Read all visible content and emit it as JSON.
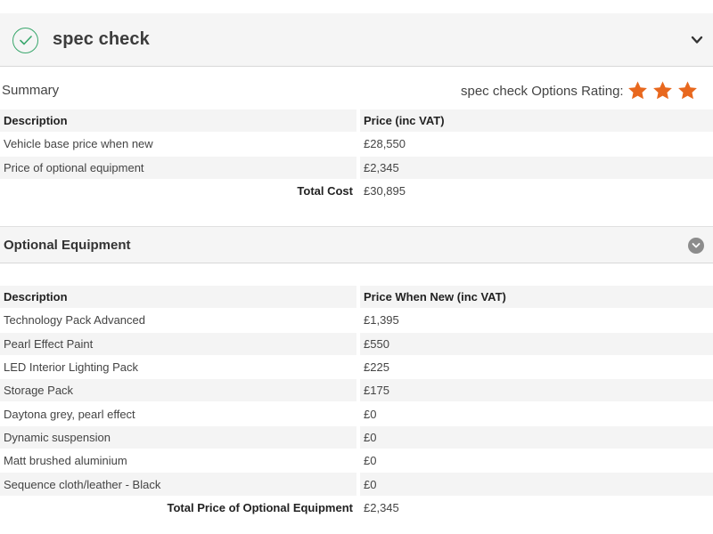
{
  "header": {
    "title": "spec check"
  },
  "summary": {
    "label": "Summary",
    "rating_label": "spec check Options Rating:",
    "rating": {
      "stars_filled": 3,
      "stars_shown": 3,
      "star_color": "#e8681e"
    },
    "columns": [
      "Description",
      "Price (inc VAT)"
    ],
    "rows": [
      {
        "description": "Vehicle base price when new",
        "price": "£28,550"
      },
      {
        "description": "Price of optional equipment",
        "price": "£2,345"
      }
    ],
    "total_label": "Total Cost",
    "total_value": "£30,895"
  },
  "optional_equipment": {
    "title": "Optional Equipment",
    "columns": [
      "Description",
      "Price When New (inc VAT)"
    ],
    "rows": [
      {
        "description": "Technology Pack Advanced",
        "price": "£1,395"
      },
      {
        "description": "Pearl Effect Paint",
        "price": "£550"
      },
      {
        "description": "LED Interior Lighting Pack",
        "price": "£225"
      },
      {
        "description": "Storage Pack",
        "price": "£175"
      },
      {
        "description": "Daytona grey, pearl effect",
        "price": "£0"
      },
      {
        "description": "Dynamic suspension",
        "price": "£0"
      },
      {
        "description": "Matt brushed aluminium",
        "price": "£0"
      },
      {
        "description": "Sequence cloth/leather - Black",
        "price": "£0"
      }
    ],
    "total_label": "Total Price of Optional Equipment",
    "total_value": "£2,345"
  },
  "icons": {
    "header_status": "check-circle-icon",
    "header_toggle": "chevron-down-icon",
    "section_toggle": "chevron-down-circle-icon",
    "rating": "star-icon"
  },
  "colors": {
    "accent_green": "#3aa76d",
    "star_orange": "#e8681e",
    "row_shade": "#f4f4f4"
  }
}
